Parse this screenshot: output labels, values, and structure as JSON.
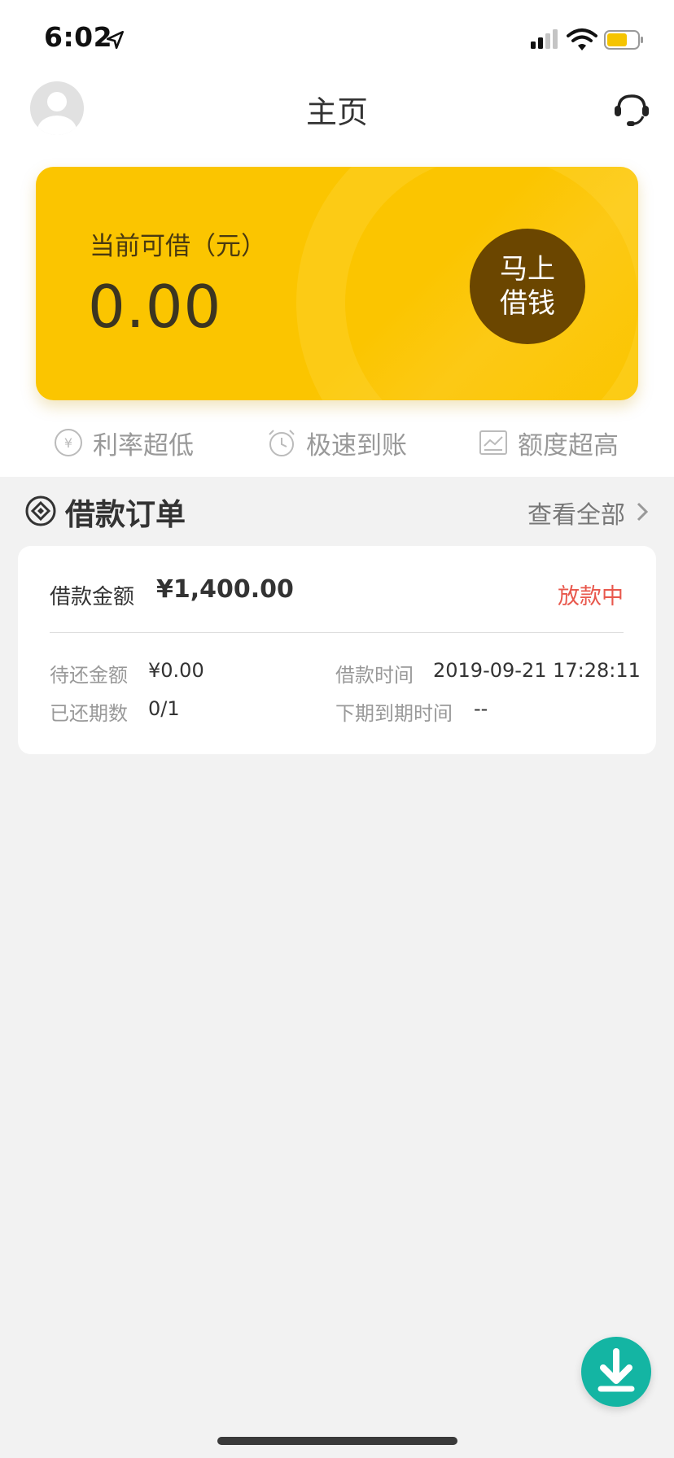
{
  "status_bar": {
    "time": "6:02"
  },
  "header": {
    "title": "主页"
  },
  "credit_card": {
    "label": "当前可借（元）",
    "amount": "0.00",
    "borrow_button_line1": "马上",
    "borrow_button_line2": "借钱"
  },
  "features": [
    {
      "icon": "yuan-circle-icon",
      "label": "利率超低"
    },
    {
      "icon": "clock-icon",
      "label": "极速到账"
    },
    {
      "icon": "chart-icon",
      "label": "额度超高"
    }
  ],
  "orders_section": {
    "title": "借款订单",
    "view_all": "查看全部"
  },
  "order": {
    "amount_label": "借款金额",
    "amount": "¥1,400.00",
    "status": "放款中",
    "pending_label": "待还金额",
    "pending_value": "¥0.00",
    "time_label": "借款时间",
    "time_value": "2019-09-21 17:28:11",
    "periods_label": "已还期数",
    "periods_value": "0/1",
    "next_due_label": "下期到期时间",
    "next_due_value": "--"
  },
  "colors": {
    "accent_yellow": "#fbc500",
    "button_brown": "#6b4600",
    "status_red": "#e8584d",
    "fab_teal": "#14b5a3"
  }
}
